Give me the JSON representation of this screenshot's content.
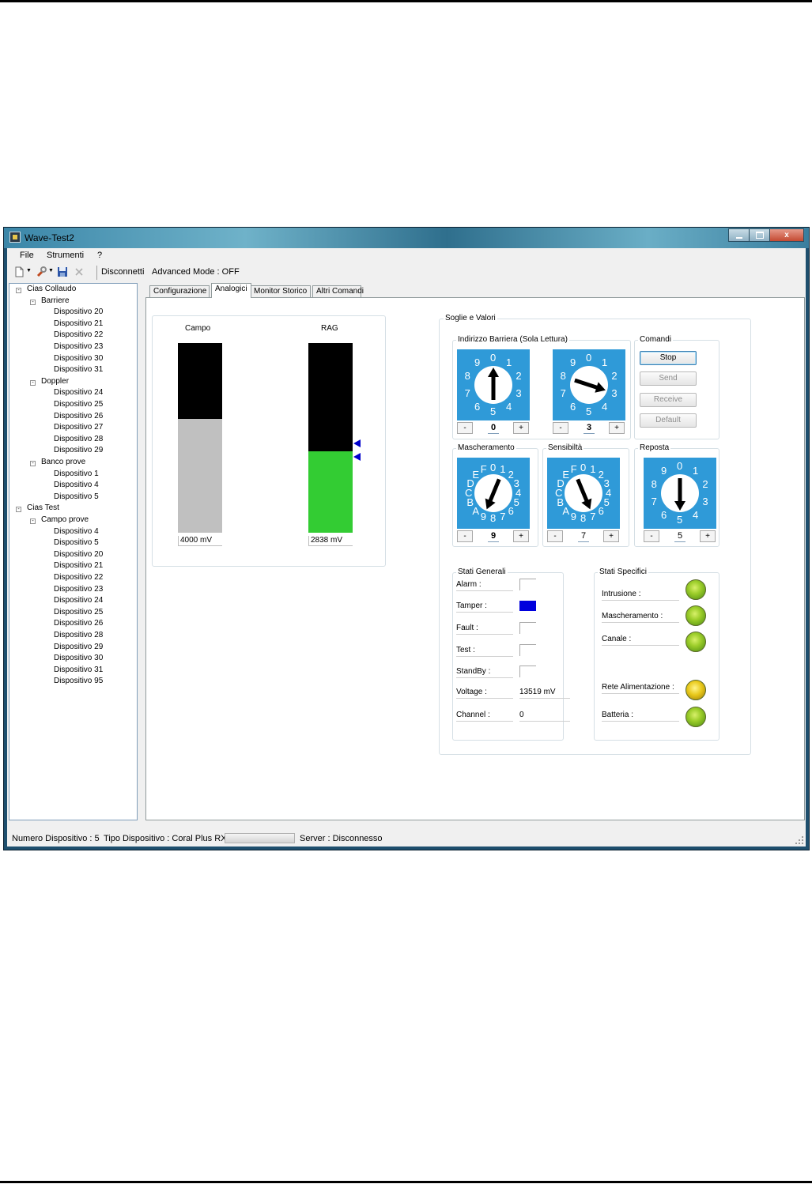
{
  "window": {
    "title": "Wave-Test2",
    "controls": {
      "minimize": "",
      "maximize": "",
      "close": "x"
    }
  },
  "menu": {
    "file": "File",
    "tools": "Strumenti",
    "help": "?"
  },
  "toolbar": {
    "disconnect": "Disconnetti",
    "advanced_mode": "Advanced Mode : OFF"
  },
  "tree": {
    "nodes": [
      {
        "label": "Cias Collaudo",
        "level": 0,
        "expander": "-"
      },
      {
        "label": "Barriere",
        "level": 1,
        "expander": "-"
      },
      {
        "label": "Dispositivo 20",
        "level": 2
      },
      {
        "label": "Dispositivo 21",
        "level": 2
      },
      {
        "label": "Dispositivo 22",
        "level": 2
      },
      {
        "label": "Dispositivo 23",
        "level": 2
      },
      {
        "label": "Dispositivo 30",
        "level": 2
      },
      {
        "label": "Dispositivo 31",
        "level": 2
      },
      {
        "label": "Doppler",
        "level": 1,
        "expander": "-"
      },
      {
        "label": "Dispositivo 24",
        "level": 2
      },
      {
        "label": "Dispositivo 25",
        "level": 2
      },
      {
        "label": "Dispositivo 26",
        "level": 2
      },
      {
        "label": "Dispositivo 27",
        "level": 2
      },
      {
        "label": "Dispositivo 28",
        "level": 2
      },
      {
        "label": "Dispositivo 29",
        "level": 2
      },
      {
        "label": "Banco prove",
        "level": 1,
        "expander": "-"
      },
      {
        "label": "Dispositivo 1",
        "level": 2
      },
      {
        "label": "Dispositivo 4",
        "level": 2
      },
      {
        "label": "Dispositivo 5",
        "level": 2
      },
      {
        "label": "Cias Test",
        "level": 0,
        "expander": "-"
      },
      {
        "label": "Campo prove",
        "level": 1,
        "expander": "-"
      },
      {
        "label": "Dispositivo 4",
        "level": 2
      },
      {
        "label": "Dispositivo 5",
        "level": 2
      },
      {
        "label": "Dispositivo 20",
        "level": 2
      },
      {
        "label": "Dispositivo 21",
        "level": 2
      },
      {
        "label": "Dispositivo 22",
        "level": 2
      },
      {
        "label": "Dispositivo 23",
        "level": 2
      },
      {
        "label": "Dispositivo 24",
        "level": 2
      },
      {
        "label": "Dispositivo 25",
        "level": 2
      },
      {
        "label": "Dispositivo 26",
        "level": 2
      },
      {
        "label": "Dispositivo 28",
        "level": 2
      },
      {
        "label": "Dispositivo 29",
        "level": 2
      },
      {
        "label": "Dispositivo 30",
        "level": 2
      },
      {
        "label": "Dispositivo 31",
        "level": 2
      },
      {
        "label": "Dispositivo 95",
        "level": 2
      }
    ]
  },
  "tabs": [
    "Configurazione",
    "Analogici",
    "Monitor Storico",
    "Altri Comandi"
  ],
  "active_tab": "Analogici",
  "analog": {
    "campo": {
      "label": "Campo",
      "value": "4000 mV",
      "fill_fraction": 0.6,
      "fill_color": "#c0c0c0"
    },
    "rag": {
      "label": "RAG",
      "value": "2838 mV",
      "fill_fraction": 0.43,
      "fill_color": "#33cc33",
      "marker_color": "#0000cc"
    }
  },
  "soglie": {
    "title": "Soglie e Valori",
    "indirizzo": {
      "title": "Indirizzo Barriera (Sola Lettura)",
      "dial1": {
        "labels": [
          "0",
          "1",
          "2",
          "3",
          "4",
          "5",
          "6",
          "7",
          "8",
          "9"
        ],
        "value": "0"
      },
      "dial2": {
        "labels": [
          "0",
          "1",
          "2",
          "3",
          "4",
          "5",
          "6",
          "7",
          "8",
          "9"
        ],
        "value": "3"
      }
    },
    "comandi": {
      "title": "Comandi",
      "stop": "Stop",
      "send": "Send",
      "receive": "Receive",
      "default": "Default"
    },
    "mascheramento": {
      "title": "Mascheramento",
      "labels": [
        "0",
        "1",
        "2",
        "3",
        "4",
        "5",
        "6",
        "7",
        "8",
        "9",
        "A",
        "B",
        "C",
        "D",
        "E",
        "F"
      ],
      "value": "9"
    },
    "sensibilita": {
      "title": "Sensibiltà",
      "labels": [
        "0",
        "1",
        "2",
        "3",
        "4",
        "5",
        "6",
        "7",
        "8",
        "9",
        "A",
        "B",
        "C",
        "D",
        "E",
        "F"
      ],
      "value": "7"
    },
    "risposta": {
      "title": "Reposta",
      "labels": [
        "0",
        "1",
        "2",
        "3",
        "4",
        "5",
        "6",
        "7",
        "8",
        "9"
      ],
      "value": "5"
    },
    "stepper": {
      "minus": "-",
      "plus": "+"
    },
    "dial_color": "#2f9ad8"
  },
  "stati_generali": {
    "title": "Stati Generali",
    "alarm": "Alarm :",
    "tamper": "Tamper :",
    "fault": "Fault :",
    "test": "Test :",
    "standby": "StandBy :",
    "voltage": "Voltage :",
    "voltage_value": "13519 mV",
    "channel": "Channel :",
    "channel_value": "0",
    "tamper_color": "#0000dd"
  },
  "stati_specifici": {
    "title": "Stati Specifici",
    "intrusione": "Intrusione :",
    "mascheramento": "Mascheramento :",
    "canale": "Canale :",
    "rete": "Rete Alimentazione :",
    "batteria": "Batteria :"
  },
  "status": {
    "device_number": "Numero Dispositivo : 5",
    "device_type": "Tipo Dispositivo : Coral Plus RX",
    "server": "Server : Disconnesso"
  }
}
